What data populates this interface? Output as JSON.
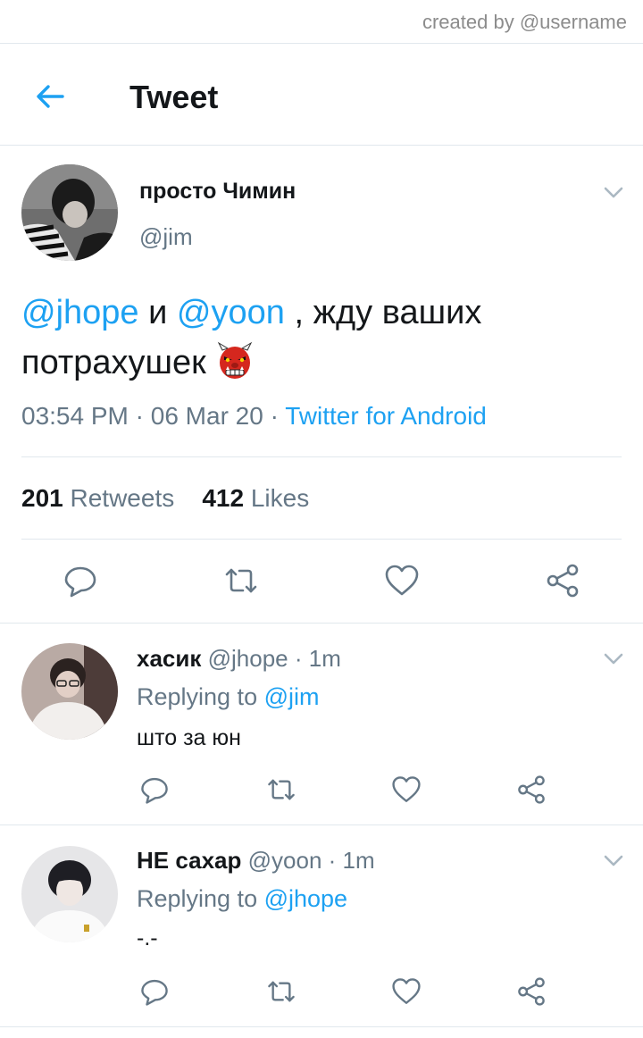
{
  "watermark": "created by @username",
  "header": {
    "title": "Tweet",
    "back_icon": "arrow-left-icon"
  },
  "colors": {
    "accent": "#1da1f2",
    "text": "#14171a",
    "muted": "#657786",
    "divider": "#e1e8ed"
  },
  "tweet": {
    "author_name": "просто Чимин",
    "author_handle": "@jim",
    "text_parts": {
      "mention1": "@jhope",
      "conj": " и ",
      "mention2": "@yoon",
      "rest_line1": " , жду ваших",
      "rest_line2": "потрахушек"
    },
    "emoji": "japanese-ogre-emoji",
    "time": "03:54 PM",
    "dot1": " · ",
    "date": "06 Mar 20",
    "dot2": " · ",
    "source": "Twitter for Android",
    "retweets_count": "201",
    "retweets_label": "Retweets",
    "likes_count": "412",
    "likes_label": "Likes"
  },
  "replies": [
    {
      "name": "хасик",
      "handle": "@jhope",
      "time": "· 1m",
      "replying_prefix": "Replying to ",
      "replying_to": "@jim",
      "text": "што за юн"
    },
    {
      "name": "НЕ сахар",
      "handle": "@yoon",
      "time": "· 1m",
      "replying_prefix": "Replying to ",
      "replying_to": "@jhope",
      "text": "-.-"
    }
  ]
}
